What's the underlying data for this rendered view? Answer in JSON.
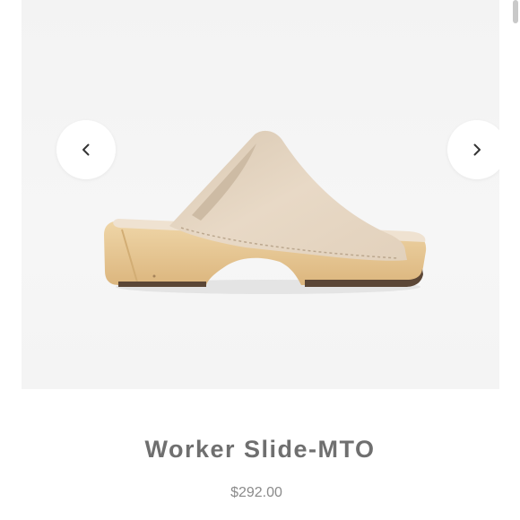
{
  "gallery": {
    "image_alt": "Worker Slide-MTO product photo",
    "prev_icon": "chevron-left-icon",
    "next_icon": "chevron-right-icon"
  },
  "product": {
    "title": "Worker Slide-MTO",
    "price": "$292.00"
  },
  "colors": {
    "title": "#6f6f6f",
    "price": "#8a8a8a",
    "leather": "#e6d7c4",
    "wood": "#e8c995"
  }
}
